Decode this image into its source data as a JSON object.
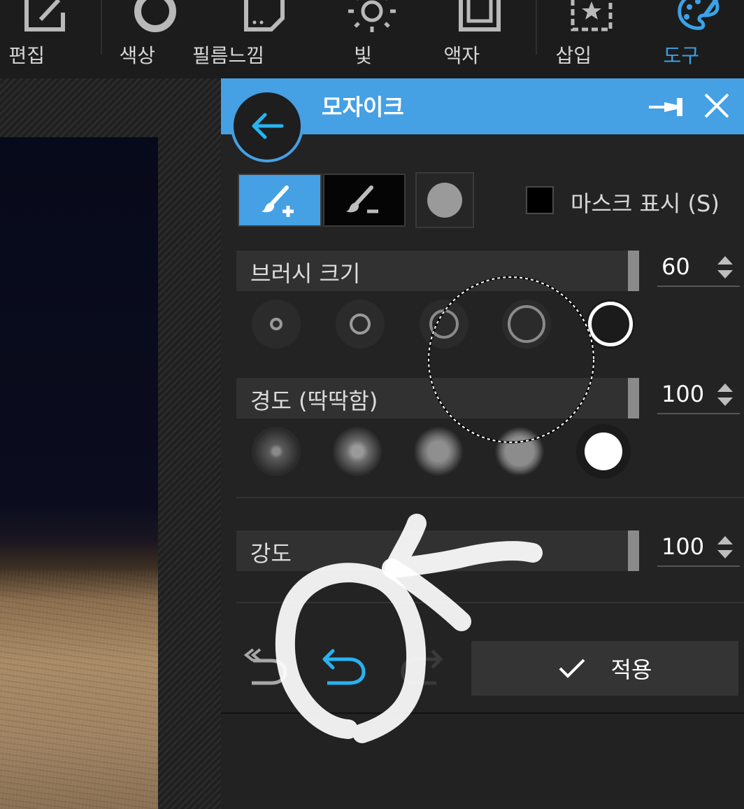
{
  "toolbar": {
    "items": [
      {
        "label": "편집",
        "icon": "edit-icon"
      },
      {
        "label": "색상",
        "icon": "color-ring-icon"
      },
      {
        "label": "필름느낌",
        "icon": "film-icon"
      },
      {
        "label": "빛",
        "icon": "sun-icon"
      },
      {
        "label": "액자",
        "icon": "frame-icon"
      },
      {
        "label": "삽입",
        "icon": "star-sticker-icon"
      },
      {
        "label": "도구",
        "icon": "palette-icon",
        "active": true
      }
    ]
  },
  "panel": {
    "title": "모자이크",
    "mask_label": "마스크 표시 (S)",
    "mask_checked": false,
    "brush_modes": [
      "add-brush-icon",
      "erase-brush-icon",
      "fill-dot-icon"
    ],
    "brush_size": {
      "label": "브러시 크기",
      "value": "60"
    },
    "hardness": {
      "label": "경도 (딱딱함)",
      "value": "100"
    },
    "strength": {
      "label": "강도",
      "value": "100"
    },
    "apply_label": "적용"
  },
  "colors": {
    "accent": "#45a0e4",
    "panel_bg": "#232323",
    "toolbar_bg": "#1c1c1c"
  }
}
